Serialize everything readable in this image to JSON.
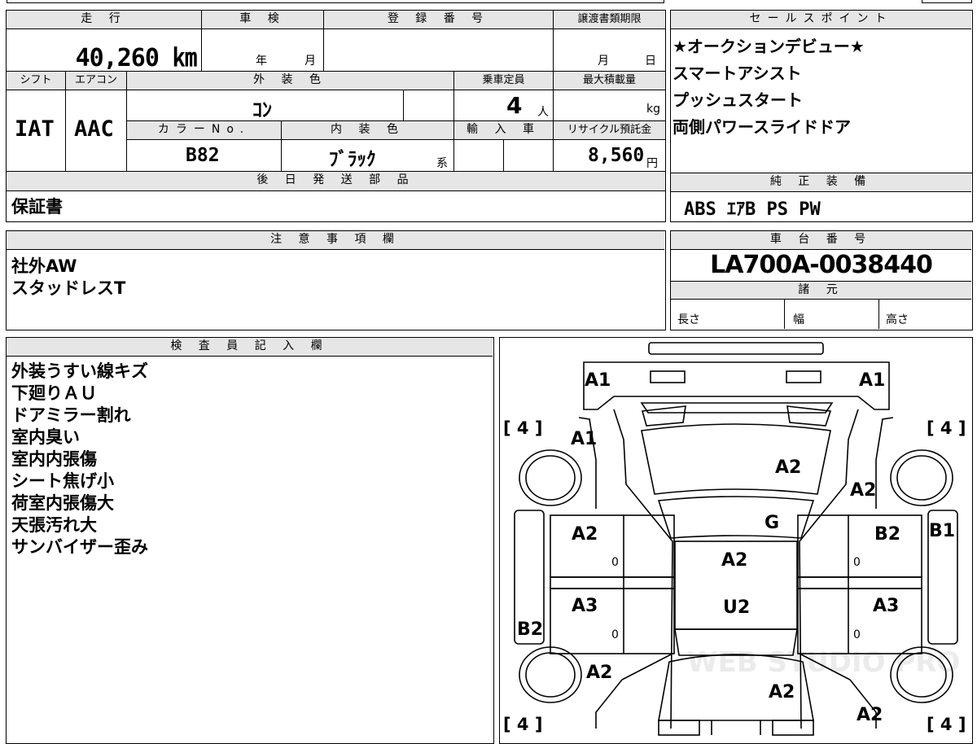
{
  "labels": {
    "mileage": "走 行",
    "inspection": "車 検",
    "registration": "登 録 番 号",
    "transfer_deadline": "譲渡書類期限",
    "sales_points": "セールスポイント",
    "shift": "シフト",
    "aircon": "エアコン",
    "exterior_color": "外 装 色",
    "capacity": "乗車定員",
    "max_load": "最大積載量",
    "color_no": "カラーNo.",
    "interior_color": "内 装 色",
    "import": "輸 入 車",
    "recycle": "リサイクル預託金",
    "later_parts": "後 日 発 送 部 品",
    "genuine_equipment": "純 正 装 備",
    "cautions": "注 意 事 項 欄",
    "chassis_number": "車 台 番 号",
    "specs": "諸 元",
    "inspector": "検 査 員 記 入 欄"
  },
  "values": {
    "mileage": "40,260 ㎞",
    "inspection_year_unit": "年",
    "inspection_month_unit": "月",
    "deadline_month_unit": "月",
    "deadline_day_unit": "日",
    "shift": "IAT",
    "aircon": "AAC",
    "exterior_color": "ｺﾝ",
    "capacity": "4",
    "capacity_unit": "人",
    "max_load_unit": "kg",
    "color_no": "B82",
    "interior_color": "ﾌﾞﾗｯｸ",
    "interior_suffix": "系",
    "recycle": "8,560",
    "recycle_unit": "円",
    "later_parts": "保証書",
    "genuine_equipment": "ABS ｴｱB PS PW",
    "chassis_number": "LA700A-0038440",
    "length": "長さ",
    "width": "幅",
    "height": "高さ"
  },
  "sales_points": [
    "★オークションデビュー★",
    "スマートアシスト",
    "プッシュスタート",
    "両側パワースライドドア"
  ],
  "cautions": [
    "社外AW",
    "スタッドレスT"
  ],
  "inspector_notes": [
    "外装うすい線キズ",
    "下廻りＡＵ",
    "ドアミラー割れ",
    "室内臭い",
    "室内内張傷",
    "シート焦げ小",
    "荷室内張傷大",
    "天張汚れ大",
    "サンバイザー歪み"
  ],
  "diagram": {
    "codes": {
      "front_left": "A1",
      "front_right": "A1",
      "fender_left": "A1",
      "hood": "A2",
      "fender_right": "A2",
      "windshield": "G",
      "front_door_left": "A2",
      "front_door_right": "B2",
      "pillar_right": "B1",
      "roof": "A2",
      "rear_door_left": "A3",
      "rear_door_right": "A3",
      "roof_rear": "U2",
      "rocker_left": "B2",
      "quarter_left": "A2",
      "back_door": "A2",
      "quarter_right": "A2"
    },
    "tire_top_left": "[ 4 ]",
    "tire_top_right": "[ 4 ]",
    "tire_bottom_left": "[ 4 ]",
    "tire_bottom_right": "[ 4 ]",
    "door_marks": "0"
  },
  "watermark": "WEB STUDIO PRO"
}
